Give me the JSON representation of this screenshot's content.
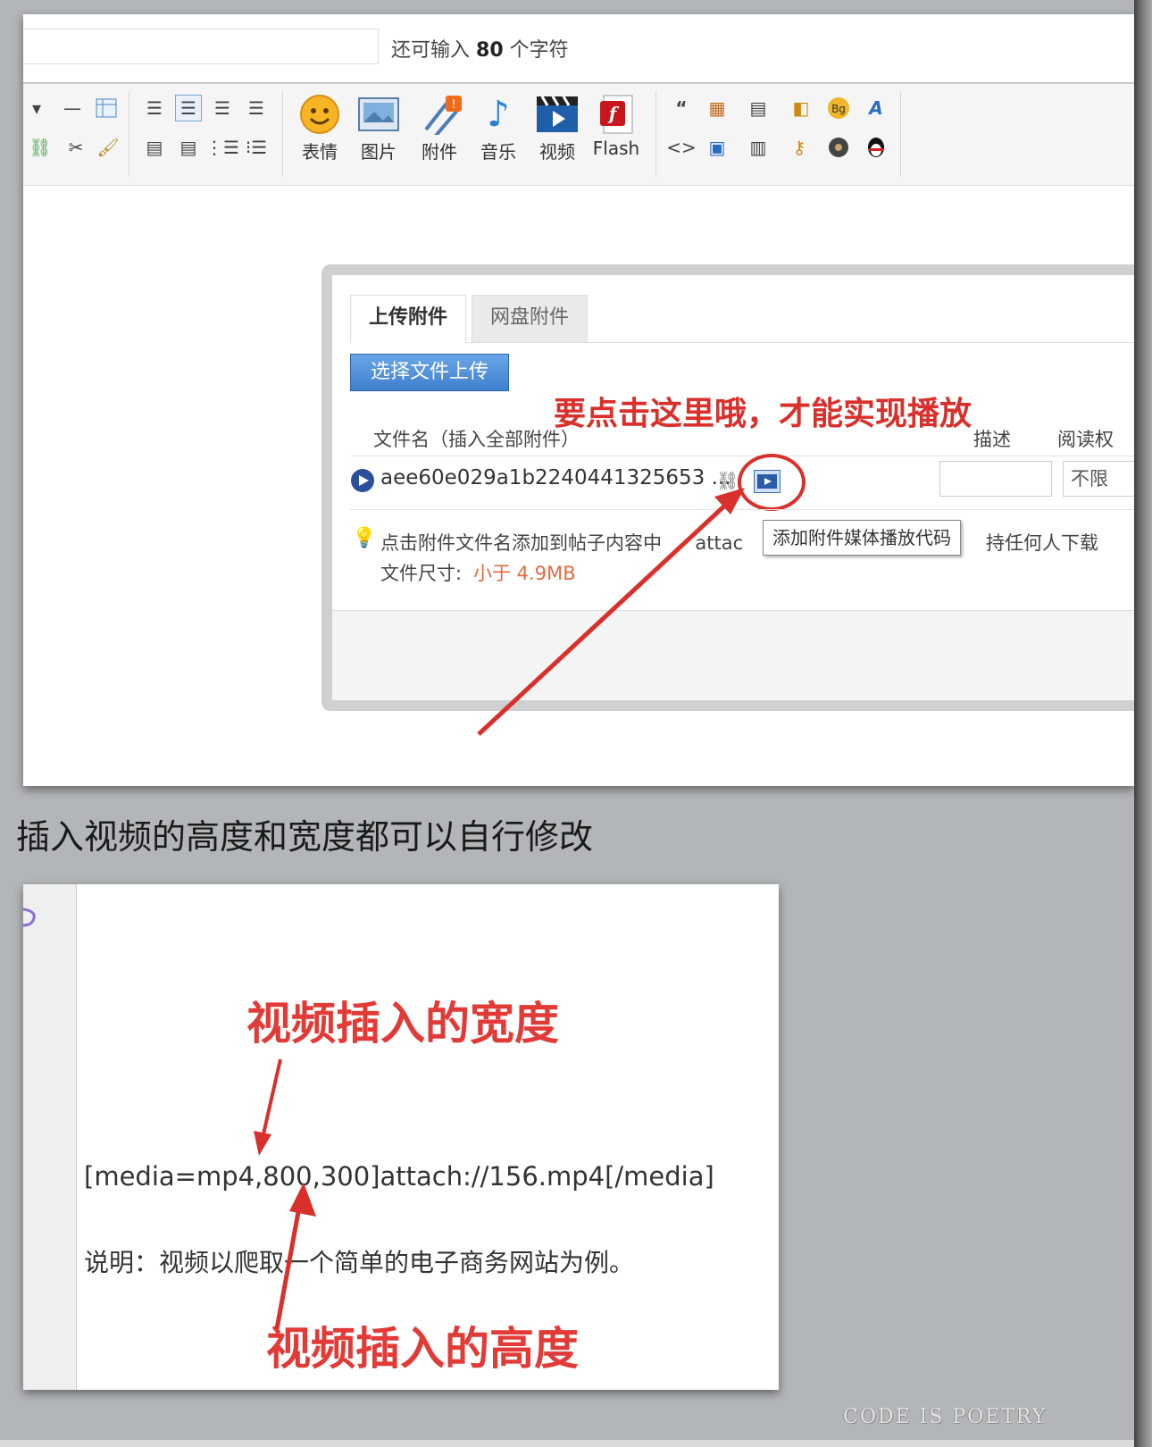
{
  "editor": {
    "title_input_value": "",
    "char_hint_prefix": "还可输入",
    "char_hint_count": "80",
    "char_hint_suffix": "个字符",
    "toolbar": {
      "emoji": "表情",
      "image": "图片",
      "attachment": "附件",
      "music": "音乐",
      "video": "视频",
      "flash": "Flash"
    }
  },
  "dialog": {
    "tabs": [
      "上传附件",
      "网盘附件"
    ],
    "upload_button": "选择文件上传",
    "annotation": "要点击这里哦，才能实现播放",
    "headers": {
      "filename": "文件名（插入全部附件）",
      "description": "描述",
      "permission": "阅读权"
    },
    "file": {
      "name": "aee60e029a1b2240441325653 ...",
      "permission": "不限"
    },
    "hint_text": "点击附件文件名添加到帖子内容中",
    "hint_attach": "attac",
    "hint_tail": "持任何人下载",
    "size_label": "文件尺寸:",
    "size_value": "小于 4.9MB",
    "tooltip": "添加附件媒体播放代码"
  },
  "caption": "插入视频的高度和宽度都可以自行修改",
  "code_example": {
    "width_annotation": "视频插入的宽度",
    "code": "[media=mp4,800,300]attach://156.mp4[/media]",
    "note": "说明：视频以爬取一个简单的电子商务网站为例。",
    "height_annotation": "视频插入的高度"
  },
  "watermark": "CODE IS POETRY",
  "colors": {
    "annotation_red": "#d9302c",
    "button_blue": "#3f7fcc",
    "size_orange": "#e36a3c"
  }
}
